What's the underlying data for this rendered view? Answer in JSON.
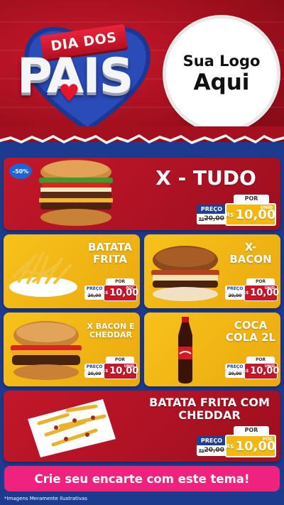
{
  "header": {
    "ribbon_text": "DIA DOS",
    "big_text": "PAIS",
    "logo_line1": "Sua Logo",
    "logo_line2": "Aqui"
  },
  "products": {
    "xtudo": {
      "name": "X - TUDO",
      "discount": "-50%",
      "por": "POR",
      "preco": "PREÇO",
      "old_prefix": "R$",
      "old": "20,00",
      "cur": "R$",
      "new": "10,00",
      "unit": "UNID"
    },
    "batata": {
      "name_l1": "BATATA",
      "name_l2": "FRITA",
      "por": "POR",
      "preco": "PREÇO",
      "old_prefix": "R$",
      "old": "20,00",
      "cur": "R$",
      "new": "10,00",
      "unit": "POC"
    },
    "xbacon": {
      "name_l1": "X-",
      "name_l2": "BACON",
      "por": "POR",
      "preco": "PREÇO",
      "old_prefix": "R$",
      "old": "20,00",
      "cur": "R$",
      "new": "10,00",
      "unit": "UNID"
    },
    "xbaconcheddar": {
      "name_l1": "X BACON E",
      "name_l2": "CHEDDAR",
      "por": "POR",
      "preco": "PREÇO",
      "old_prefix": "R$",
      "old": "20,00",
      "cur": "R$",
      "new": "10,00",
      "unit": "UNID"
    },
    "coca": {
      "name_l1": "COCA",
      "name_l2": "COLA 2L",
      "por": "POR",
      "preco": "PREÇO",
      "old_prefix": "R$",
      "old": "20,00",
      "cur": "R$",
      "new": "10,00",
      "unit": "UNID"
    },
    "batatacheddar": {
      "name_l1": "BATATA FRITA COM",
      "name_l2": "CHEDDAR",
      "por": "POR",
      "preco": "PREÇO",
      "old_prefix": "R$",
      "old": "20,00",
      "cur": "R$",
      "new": "10,00",
      "unit": "POC"
    }
  },
  "cta": "Crie seu encarte com este tema!",
  "footnote": "*Imagens Meramente Ilustrativas",
  "colors": {
    "red": "#c3172a",
    "yellow": "#f7c21b",
    "blue": "#1c3b8f",
    "pink": "#f0227f",
    "price_yellow": "#f6b80f"
  }
}
